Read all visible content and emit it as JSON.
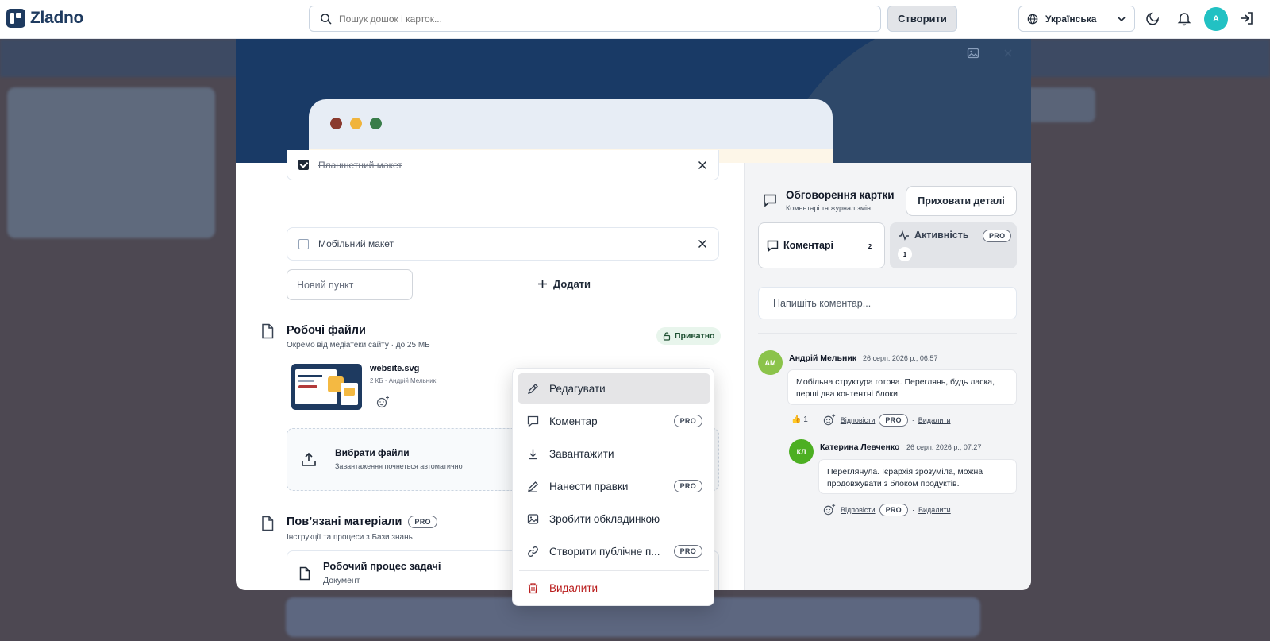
{
  "header": {
    "logo_text": "Zladno",
    "search_placeholder": "Пошук дошок і карток...",
    "create_label": "Створити",
    "language_label": "Українська",
    "avatar_initial": "A"
  },
  "checklist": {
    "items": [
      {
        "label": "Планшетний макет",
        "checked": true
      },
      {
        "label": "Мобільний макет",
        "checked": false
      }
    ],
    "new_item_placeholder": "Новий пункт",
    "add_label": "Додати"
  },
  "work_files": {
    "title": "Робочі файли",
    "subtitle": "Окремо від медіатеки сайту · до 25 МБ",
    "private_label": "Приватно",
    "file": {
      "name": "website.svg",
      "meta": "2 КБ · Андрій Мельник"
    },
    "upload_title": "Вибрати файли",
    "upload_subtitle": "Завантаження почнеться автоматично"
  },
  "related": {
    "title": "Пов’язані матеріали",
    "pro_label": "PRO",
    "subtitle": "Інструкції та процеси з Бази знань",
    "item_title": "Робочий процес задачі",
    "item_type": "Документ"
  },
  "discussion": {
    "title": "Обговорення картки",
    "subtitle": "Коментарі та журнал змін",
    "hide_details_label": "Приховати деталі",
    "tabs": [
      {
        "label": "Коментарі",
        "count": "2"
      },
      {
        "label": "Активність",
        "count": "1",
        "pro": "PRO"
      }
    ],
    "comment_placeholder": "Напишіть коментар...",
    "comments": [
      {
        "initials": "АМ",
        "author": "Андрій Мельник",
        "date": "26 серп. 2026 р., 06:57",
        "text": "Мобільна структура готова. Переглянь, будь ласка, перші два контентні блоки.",
        "reaction": "👍 1",
        "reply_label": "Відповісти",
        "pro_label": "PRO",
        "delete_label": "Видалити",
        "avatar_color": "#8bc34a"
      },
      {
        "initials": "КЛ",
        "author": "Катерина Левченко",
        "date": "26 серп. 2026 р., 07:27",
        "text": "Переглянула. Ієрархія зрозуміла, можна продовжувати з блоком продуктів.",
        "reply_label": "Відповісти",
        "pro_label": "PRO",
        "delete_label": "Видалити",
        "avatar_color": "#4caf22"
      }
    ]
  },
  "context_menu": {
    "items": [
      {
        "label": "Редагувати",
        "icon": "pencil-icon"
      },
      {
        "label": "Коментар",
        "icon": "comment-icon",
        "pro": "PRO"
      },
      {
        "label": "Завантажити",
        "icon": "download-icon"
      },
      {
        "label": "Нанести правки",
        "icon": "pen-icon",
        "pro": "PRO"
      },
      {
        "label": "Зробити обкладинкою",
        "icon": "image-icon"
      },
      {
        "label": "Створити публічне п...",
        "icon": "link-icon",
        "pro": "PRO"
      },
      {
        "label": "Видалити",
        "icon": "trash-icon"
      }
    ]
  },
  "colors": {
    "brand": "#1e3a5f",
    "cover": "#193a66",
    "danger": "#b91c1c",
    "private_bg": "#e8f5ec"
  }
}
